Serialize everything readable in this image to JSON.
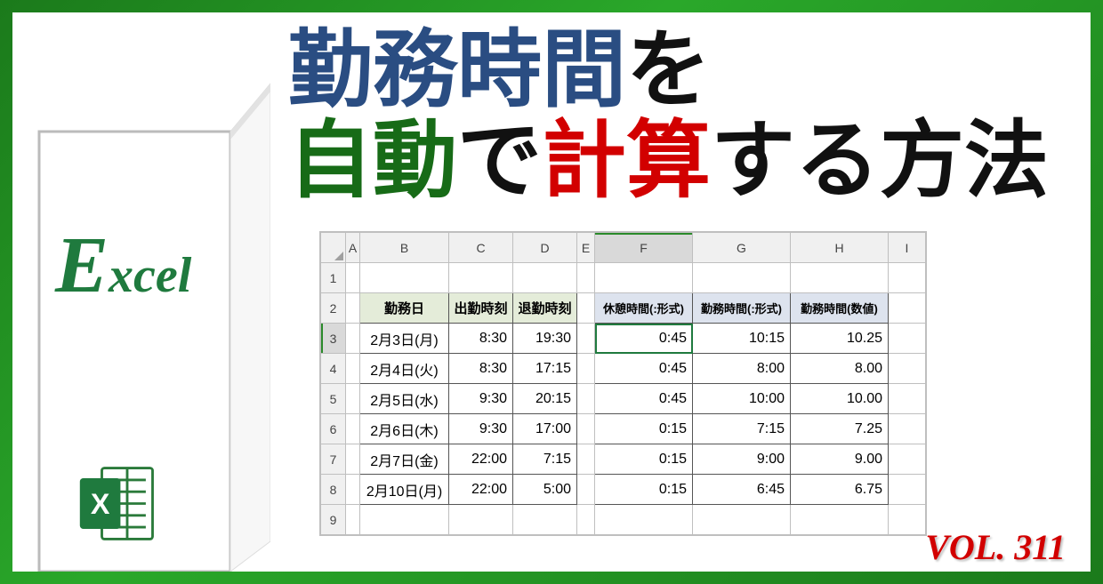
{
  "branding": {
    "initial": "E",
    "rest": "xcel",
    "icon_name": "excel-icon"
  },
  "headline": {
    "line1_blue": "勤務時間",
    "line1_black": "を",
    "line2_green": "自動",
    "line2_black1": "で",
    "line2_red": "計算",
    "line2_black2": "する方法"
  },
  "volume_label": "VOL. 311",
  "sheet": {
    "columns": [
      "A",
      "B",
      "C",
      "D",
      "E",
      "F",
      "G",
      "H",
      "I"
    ],
    "row_numbers": [
      1,
      2,
      3,
      4,
      5,
      6,
      7,
      8,
      9
    ],
    "selected_cell": "F3",
    "header1": {
      "B": "勤務日",
      "C": "出勤時刻",
      "D": "退勤時刻"
    },
    "header2": {
      "F": "休憩時間(:形式)",
      "G": "勤務時間(:形式)",
      "H": "勤務時間(数値)"
    },
    "rows": [
      {
        "r": 3,
        "B": "2月3日(月)",
        "C": "8:30",
        "D": "19:30",
        "F": "0:45",
        "G": "10:15",
        "H": "10.25"
      },
      {
        "r": 4,
        "B": "2月4日(火)",
        "C": "8:30",
        "D": "17:15",
        "F": "0:45",
        "G": "8:00",
        "H": "8.00"
      },
      {
        "r": 5,
        "B": "2月5日(水)",
        "C": "9:30",
        "D": "20:15",
        "F": "0:45",
        "G": "10:00",
        "H": "10.00"
      },
      {
        "r": 6,
        "B": "2月6日(木)",
        "C": "9:30",
        "D": "17:00",
        "F": "0:15",
        "G": "7:15",
        "H": "7.25"
      },
      {
        "r": 7,
        "B": "2月7日(金)",
        "C": "22:00",
        "D": "7:15",
        "F": "0:15",
        "G": "9:00",
        "H": "9.00"
      },
      {
        "r": 8,
        "B": "2月10日(月)",
        "C": "22:00",
        "D": "5:00",
        "F": "0:15",
        "G": "6:45",
        "H": "6.75"
      }
    ]
  }
}
